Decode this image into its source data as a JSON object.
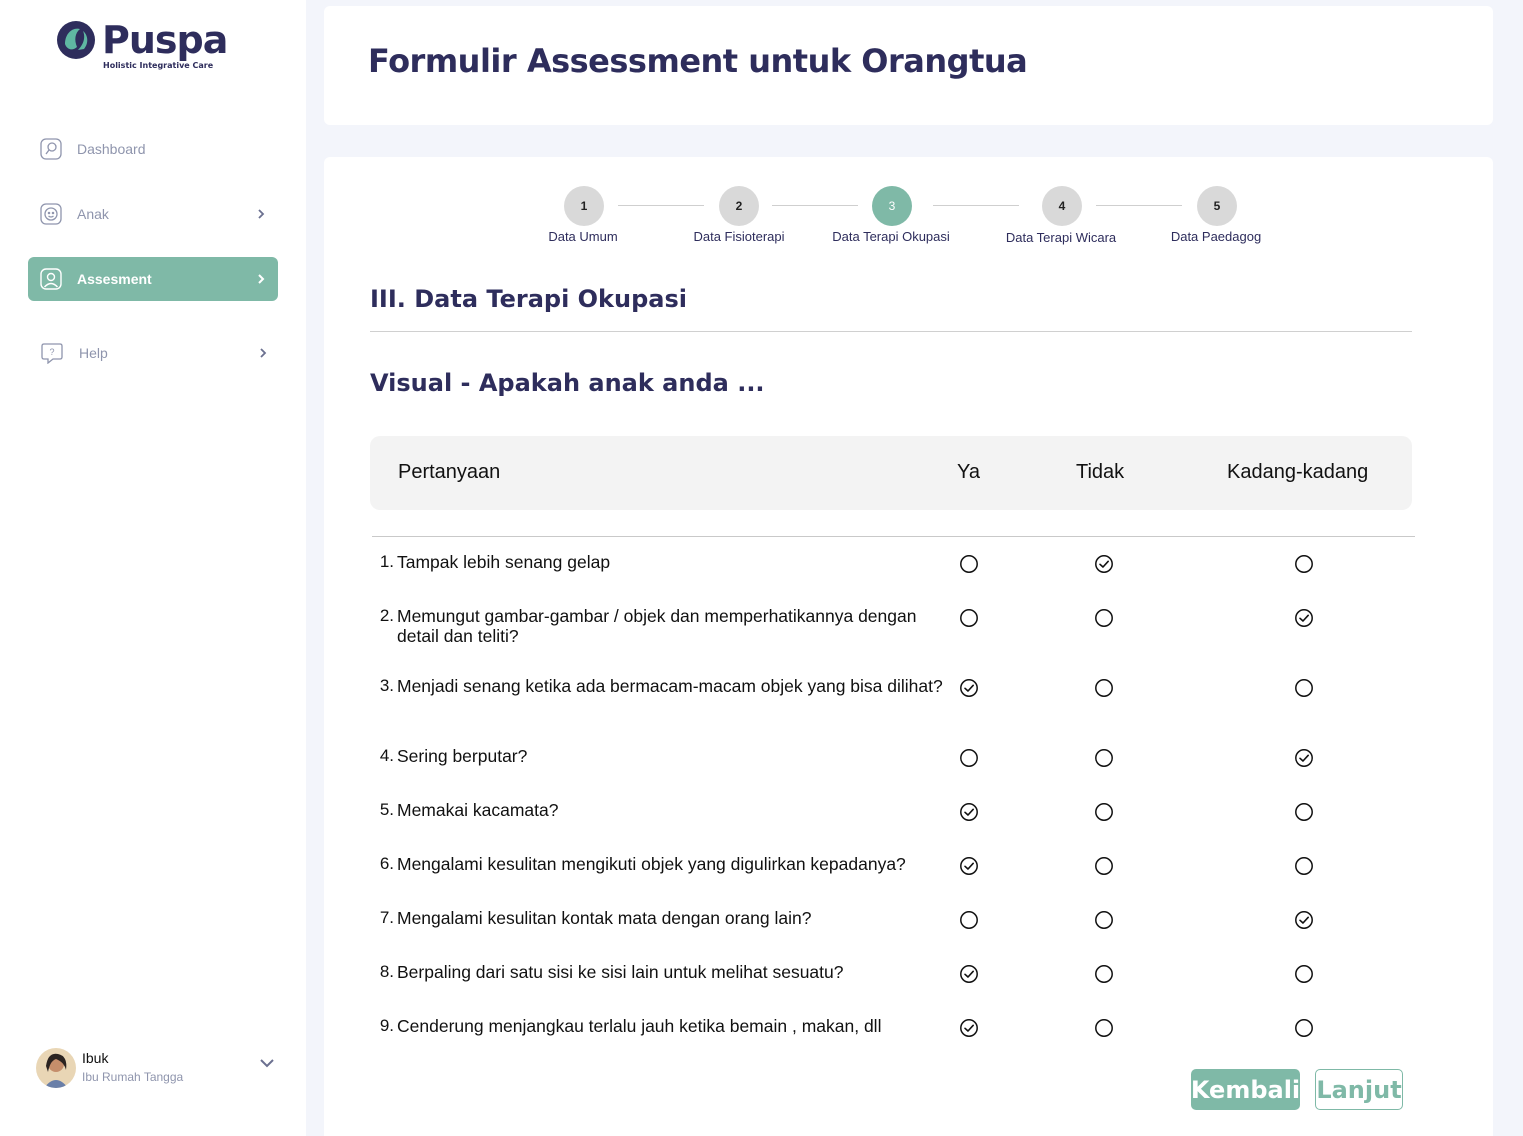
{
  "brand": {
    "name": "Puspa",
    "tagline": "Holistic Integrative Care",
    "accent": "#7fb9a7",
    "navy": "#2e2d5c"
  },
  "sidebar": {
    "items": [
      {
        "label": "Dashboard",
        "icon": "dashboard-icon",
        "active": false,
        "has_chevron": false
      },
      {
        "label": "Anak",
        "icon": "child-face-icon",
        "active": false,
        "has_chevron": true
      },
      {
        "label": "Assesment",
        "icon": "user-profile-icon",
        "active": true,
        "has_chevron": true
      },
      {
        "label": "Help",
        "icon": "help-icon",
        "active": false,
        "has_chevron": true
      }
    ],
    "user": {
      "name": "Ibuk",
      "role": "Ibu Rumah Tangga"
    }
  },
  "header": {
    "title": "Formulir Assessment untuk Orangtua"
  },
  "stepper": {
    "steps": [
      {
        "number": "1",
        "label": "Data Umum",
        "active": false
      },
      {
        "number": "2",
        "label": "Data Fisioterapi",
        "active": false
      },
      {
        "number": "3",
        "label": "Data Terapi Okupasi",
        "active": true
      },
      {
        "number": "4",
        "label": "Data Terapi Wicara",
        "active": false
      },
      {
        "number": "5",
        "label": "Data Paedagog",
        "active": false
      }
    ]
  },
  "section": {
    "title": "III. Data Terapi Okupasi",
    "subtitle": "Visual - Apakah anak anda ..."
  },
  "table": {
    "headers": {
      "question": "Pertanyaan",
      "yes": "Ya",
      "no": "Tidak",
      "sometimes": "Kadang-kadang"
    },
    "rows": [
      {
        "num": "1.",
        "text": "Tampak lebih senang gelap",
        "answer": "no"
      },
      {
        "num": "2.",
        "text": "Memungut gambar-gambar  / objek  dan memperhatikannya dengan detail dan teliti?",
        "answer": "sometimes"
      },
      {
        "num": "3.",
        "text": "Menjadi senang ketika ada bermacam-macam objek yang bisa dilihat?",
        "answer": "yes"
      },
      {
        "num": "4.",
        "text": "Sering berputar?",
        "answer": "sometimes"
      },
      {
        "num": "5.",
        "text": "Memakai kacamata?",
        "answer": "yes"
      },
      {
        "num": "6.",
        "text": "Mengalami kesulitan mengikuti objek yang digulirkan kepadanya?",
        "answer": "yes"
      },
      {
        "num": "7.",
        "text": "Mengalami kesulitan kontak mata dengan orang lain?",
        "answer": "sometimes"
      },
      {
        "num": "8.",
        "text": "Berpaling dari satu sisi ke sisi lain untuk melihat sesuatu?",
        "answer": "yes"
      },
      {
        "num": "9.",
        "text": "Cenderung menjangkau terlalu jauh ketika bemain , makan, dll",
        "answer": "yes"
      }
    ]
  },
  "actions": {
    "back_label": "Kembali",
    "next_label": "Lanjut"
  }
}
